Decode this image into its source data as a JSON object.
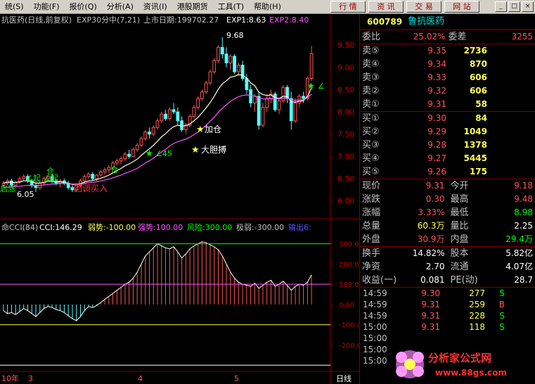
{
  "menu": {
    "items": [
      "统(S)",
      "功能(F)",
      "报价(Q)",
      "分析(A)",
      "资讯(I)",
      "港股期货",
      "工具(T)",
      "帮助(H)"
    ]
  },
  "toolbar": {
    "buttons": [
      "行 情",
      "资 讯",
      "交 易",
      "网 站"
    ]
  },
  "window_buttons": [
    "_",
    "□",
    "×"
  ],
  "chart": {
    "title": "抗医药(日线,前复权)",
    "exp_label": "EXP30分中(7,21)",
    "list_date": "上市日期:199702.27",
    "exp1": "EXP1:8.63",
    "exp2": "EXP2:8.40",
    "price_axis": [
      "9.50",
      "9.00",
      "8.50",
      "8.00",
      "7.50",
      "7.00",
      "6.50",
      "6.00"
    ],
    "annotations": {
      "high": "9.68",
      "low": "6.05",
      "add": "加仓",
      "bold": "大胆搏",
      "buy": "回调买入",
      "l45": "∠45",
      "start1": "∠起",
      "start2": "∠起",
      "pos1": "仓",
      "pos2": "仓",
      "left": "启涨",
      "right_mark": "∠"
    },
    "cci_header": {
      "name": "命CCI(84)",
      "cci": "CCI:146.29",
      "weak": "弱势:-100.00",
      "strong": "强势:100.00",
      "risk": "风险:300.00",
      "extreme": "极弱:-300.00",
      "out": "输出6:"
    },
    "cci_axis": [
      "300.00",
      "200.00",
      "100.00",
      "0.00",
      "-100.00",
      "-200.00"
    ],
    "dates": [
      "10年",
      "3",
      "4",
      "5"
    ],
    "period": "日线"
  },
  "quote": {
    "code": "600789",
    "name": "鲁抗医药",
    "weibi_label": "委比",
    "weibi": "25.02%",
    "weicha_label": "委差",
    "weicha": "3255",
    "sells": [
      {
        "label": "卖⑤",
        "price": "9.35",
        "vol": "2736"
      },
      {
        "label": "卖④",
        "price": "9.34",
        "vol": "870"
      },
      {
        "label": "卖③",
        "price": "9.33",
        "vol": "606"
      },
      {
        "label": "卖②",
        "price": "9.32",
        "vol": "606"
      },
      {
        "label": "卖①",
        "price": "9.31",
        "vol": "58"
      }
    ],
    "buys": [
      {
        "label": "买①",
        "price": "9.30",
        "vol": "84"
      },
      {
        "label": "买②",
        "price": "9.29",
        "vol": "1049"
      },
      {
        "label": "买③",
        "price": "9.28",
        "vol": "1378"
      },
      {
        "label": "买④",
        "price": "9.27",
        "vol": "5445"
      },
      {
        "label": "买⑤",
        "price": "9.26",
        "vol": "175"
      }
    ],
    "stats": [
      {
        "l1": "现价",
        "v1": "9.31",
        "c1": "red",
        "l2": "今开",
        "v2": "9.18",
        "c2": "red"
      },
      {
        "l1": "涨跌",
        "v1": "0.30",
        "c1": "red",
        "l2": "最高",
        "v2": "9.48",
        "c2": "red"
      },
      {
        "l1": "涨幅",
        "v1": "3.33%",
        "c1": "red",
        "l2": "最低",
        "v2": "8.98",
        "c2": "grn"
      },
      {
        "l1": "总量",
        "v1": "60.3万",
        "c1": "yel",
        "l2": "量比",
        "v2": "2.25",
        "c2": "wht"
      },
      {
        "l1": "外盘",
        "v1": "30.9万",
        "c1": "red",
        "l2": "内盘",
        "v2": "29.4万",
        "c2": "grn"
      }
    ],
    "stats2": [
      {
        "l1": "换手",
        "v1": "14.82%",
        "l2": "股本",
        "v2": "5.82亿"
      },
      {
        "l1": "净资",
        "v1": "2.70",
        "l2": "流通",
        "v2": "4.07亿"
      },
      {
        "l1": "收益(一)",
        "v1": "0.081",
        "l2": "PE(动)",
        "v2": "28.7"
      }
    ],
    "ticks": [
      {
        "t": "14:59",
        "p": "9.30",
        "v": "277",
        "f": "S"
      },
      {
        "t": "14:59",
        "p": "9.31",
        "v": "259",
        "f": "B"
      },
      {
        "t": "14:59",
        "p": "9.31",
        "v": "228",
        "f": "S"
      },
      {
        "t": "15:00",
        "p": "9.31",
        "v": "118",
        "f": "S"
      },
      {
        "t": "15:00",
        "p": "",
        "v": "",
        "f": ""
      },
      {
        "t": "15:00",
        "p": "",
        "v": "",
        "f": ""
      },
      {
        "t": "15:00",
        "p": "",
        "v": "",
        "f": ""
      }
    ]
  },
  "watermark": {
    "text": "分析家公式网",
    "url": "www.88gs.com"
  },
  "chart_data": {
    "type": "line",
    "candles": [
      [
        6.35,
        6.45,
        6.3,
        6.4
      ],
      [
        6.4,
        6.5,
        6.35,
        6.45
      ],
      [
        6.45,
        6.5,
        6.3,
        6.35
      ],
      [
        6.35,
        6.45,
        6.3,
        6.42
      ],
      [
        6.42,
        6.55,
        6.38,
        6.5
      ],
      [
        6.5,
        6.6,
        6.45,
        6.55
      ],
      [
        6.55,
        6.6,
        6.4,
        6.45
      ],
      [
        6.45,
        6.5,
        6.3,
        6.35
      ],
      [
        6.35,
        6.42,
        6.2,
        6.3
      ],
      [
        6.3,
        6.45,
        6.25,
        6.4
      ],
      [
        6.4,
        6.55,
        6.35,
        6.5
      ],
      [
        6.5,
        6.6,
        6.45,
        6.55
      ],
      [
        6.55,
        6.6,
        6.4,
        6.45
      ],
      [
        6.45,
        6.5,
        6.35,
        6.4
      ],
      [
        6.4,
        6.5,
        6.3,
        6.45
      ],
      [
        6.45,
        6.5,
        6.35,
        6.4
      ],
      [
        6.4,
        6.45,
        6.25,
        6.3
      ],
      [
        6.3,
        6.35,
        6.2,
        6.25
      ],
      [
        6.25,
        6.4,
        6.2,
        6.35
      ],
      [
        6.35,
        6.5,
        6.3,
        6.45
      ],
      [
        6.45,
        6.6,
        6.4,
        6.55
      ],
      [
        6.55,
        6.65,
        6.5,
        6.6
      ],
      [
        6.6,
        6.65,
        6.45,
        6.5
      ],
      [
        6.5,
        6.6,
        6.45,
        6.58
      ],
      [
        6.58,
        6.7,
        6.55,
        6.65
      ],
      [
        6.65,
        6.75,
        6.6,
        6.7
      ],
      [
        6.7,
        6.8,
        6.62,
        6.75
      ],
      [
        6.75,
        6.9,
        6.7,
        6.85
      ],
      [
        6.85,
        6.95,
        6.8,
        6.9
      ],
      [
        6.9,
        7.0,
        6.82,
        6.95
      ],
      [
        6.95,
        7.1,
        6.9,
        7.05
      ],
      [
        7.05,
        7.15,
        6.95,
        7.0
      ],
      [
        7.0,
        7.2,
        6.98,
        7.15
      ],
      [
        7.15,
        7.3,
        7.1,
        7.25
      ],
      [
        7.25,
        7.45,
        7.2,
        7.4
      ],
      [
        7.4,
        7.6,
        7.35,
        7.55
      ],
      [
        7.55,
        7.65,
        7.4,
        7.5
      ],
      [
        7.5,
        7.7,
        7.45,
        7.65
      ],
      [
        7.65,
        7.85,
        7.6,
        7.8
      ],
      [
        7.8,
        8.0,
        7.75,
        7.95
      ],
      [
        7.95,
        8.05,
        7.8,
        7.85
      ],
      [
        7.85,
        8.1,
        7.8,
        8.05
      ],
      [
        8.05,
        8.2,
        7.95,
        8.0
      ],
      [
        8.0,
        8.1,
        7.7,
        7.8
      ],
      [
        7.8,
        7.9,
        7.55,
        7.6
      ],
      [
        7.6,
        7.75,
        7.5,
        7.7
      ],
      [
        7.7,
        7.95,
        7.65,
        7.9
      ],
      [
        7.9,
        8.15,
        7.85,
        8.1
      ],
      [
        8.1,
        8.35,
        8.05,
        8.3
      ],
      [
        8.3,
        8.5,
        8.25,
        8.45
      ],
      [
        8.45,
        8.7,
        8.4,
        8.65
      ],
      [
        8.65,
        8.95,
        8.6,
        8.9
      ],
      [
        8.9,
        9.2,
        8.85,
        9.15
      ],
      [
        9.15,
        9.5,
        9.1,
        9.45
      ],
      [
        9.45,
        9.68,
        9.2,
        9.3
      ],
      [
        9.3,
        9.45,
        9.0,
        9.1
      ],
      [
        9.1,
        9.3,
        8.95,
        9.25
      ],
      [
        9.25,
        9.3,
        8.85,
        8.9
      ],
      [
        8.9,
        9.1,
        8.8,
        9.05
      ],
      [
        9.05,
        9.15,
        8.7,
        8.75
      ],
      [
        8.75,
        8.85,
        8.4,
        8.5
      ],
      [
        8.5,
        8.6,
        8.1,
        8.2
      ],
      [
        8.2,
        8.4,
        8.0,
        8.35
      ],
      [
        8.35,
        8.45,
        7.6,
        7.7
      ],
      [
        7.7,
        8.2,
        7.65,
        8.1
      ],
      [
        8.1,
        8.4,
        8.0,
        8.3
      ],
      [
        8.3,
        8.5,
        8.2,
        8.4
      ],
      [
        8.4,
        8.45,
        8.0,
        8.05
      ],
      [
        8.05,
        8.3,
        7.95,
        8.25
      ],
      [
        8.25,
        8.6,
        8.2,
        8.55
      ],
      [
        8.55,
        8.6,
        8.2,
        8.3
      ],
      [
        8.3,
        8.45,
        7.6,
        7.8
      ],
      [
        7.8,
        8.3,
        7.75,
        8.2
      ],
      [
        8.2,
        8.4,
        8.1,
        8.35
      ],
      [
        8.35,
        8.45,
        8.2,
        8.3
      ],
      [
        8.3,
        8.8,
        8.25,
        8.75
      ],
      [
        8.75,
        9.48,
        8.7,
        9.31
      ]
    ],
    "exp1": [
      6.4,
      6.42,
      6.42,
      6.41,
      6.43,
      6.45,
      6.45,
      6.43,
      6.4,
      6.4,
      6.42,
      6.44,
      6.44,
      6.43,
      6.43,
      6.42,
      6.4,
      6.37,
      6.37,
      6.39,
      6.42,
      6.45,
      6.46,
      6.48,
      6.51,
      6.54,
      6.58,
      6.63,
      6.68,
      6.73,
      6.79,
      6.83,
      6.88,
      6.94,
      7.02,
      7.1,
      7.17,
      7.25,
      7.34,
      7.44,
      7.51,
      7.6,
      7.67,
      7.7,
      7.68,
      7.69,
      7.73,
      7.8,
      7.88,
      7.98,
      8.09,
      8.21,
      8.35,
      8.51,
      8.63,
      8.7,
      8.78,
      8.8,
      8.84,
      8.82,
      8.76,
      8.65,
      8.59,
      8.44,
      8.39,
      8.37,
      8.38,
      8.32,
      8.3,
      8.35,
      8.34,
      8.23,
      8.22,
      8.24,
      8.25,
      8.35,
      8.54
    ],
    "exp2": [
      6.3,
      6.31,
      6.32,
      6.32,
      6.33,
      6.34,
      6.35,
      6.35,
      6.35,
      6.35,
      6.36,
      6.37,
      6.38,
      6.38,
      6.39,
      6.39,
      6.39,
      6.38,
      6.38,
      6.38,
      6.39,
      6.41,
      6.42,
      6.43,
      6.45,
      6.47,
      6.49,
      6.52,
      6.55,
      6.58,
      6.62,
      6.65,
      6.69,
      6.73,
      6.79,
      6.85,
      6.9,
      6.96,
      7.03,
      7.1,
      7.16,
      7.23,
      7.29,
      7.33,
      7.36,
      7.39,
      7.43,
      7.49,
      7.55,
      7.62,
      7.7,
      7.79,
      7.88,
      7.99,
      8.08,
      8.16,
      8.24,
      8.29,
      8.34,
      8.37,
      8.38,
      8.37,
      8.36,
      8.31,
      8.29,
      8.29,
      8.3,
      8.29,
      8.29,
      8.31,
      8.31,
      8.27,
      8.26,
      8.27,
      8.27,
      8.32,
      8.4
    ],
    "cci": [
      -30,
      -45,
      -40,
      -50,
      -35,
      -20,
      -30,
      -45,
      -60,
      -40,
      -20,
      -10,
      -15,
      -25,
      -30,
      -40,
      -55,
      -70,
      -80,
      -60,
      -30,
      -10,
      -15,
      -5,
      10,
      25,
      40,
      55,
      70,
      85,
      100,
      110,
      130,
      160,
      200,
      240,
      260,
      280,
      300,
      290,
      280,
      275,
      285,
      260,
      230,
      250,
      275,
      290,
      300,
      310,
      305,
      295,
      285,
      270,
      240,
      200,
      160,
      130,
      110,
      100,
      95,
      90,
      105,
      80,
      95,
      110,
      120,
      90,
      100,
      115,
      95,
      70,
      90,
      100,
      95,
      110,
      146
    ],
    "ylim": [
      5.9,
      9.85
    ],
    "cci_ylim": [
      -320,
      330
    ]
  }
}
